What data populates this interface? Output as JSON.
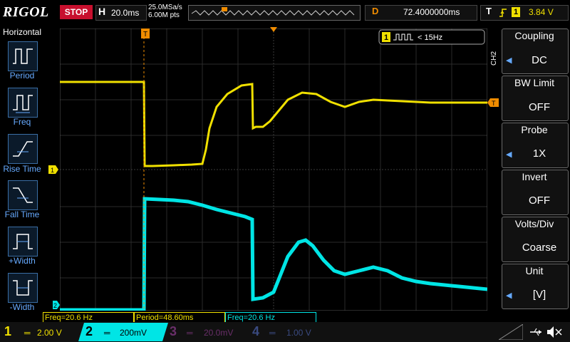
{
  "brand": "RIGOL",
  "run_state": "STOP",
  "horizontal": {
    "label": "H",
    "timebase": "20.0ms",
    "sample_rate": "25.0MSa/s",
    "memory": "6.00M pts"
  },
  "delay": {
    "label": "D",
    "value": "72.4000000ms"
  },
  "trigger": {
    "label": "T",
    "source": "1",
    "level": "3.84 V",
    "marker": "T"
  },
  "left_menu": {
    "title": "Horizontal",
    "items": [
      {
        "label": "Period",
        "icon": "period-icon"
      },
      {
        "label": "Freq",
        "icon": "freq-icon"
      },
      {
        "label": "Rise Time",
        "icon": "rise-time-icon"
      },
      {
        "label": "Fall Time",
        "icon": "fall-time-icon"
      },
      {
        "label": "+Width",
        "icon": "positive-width-icon"
      },
      {
        "label": "-Width",
        "icon": "negative-width-icon"
      }
    ]
  },
  "counter": {
    "channel": "1",
    "text": "< 15Hz"
  },
  "right_menu": {
    "channel_tag": "CH2",
    "items": [
      {
        "header": "Coupling",
        "value": "DC"
      },
      {
        "header": "BW Limit",
        "value": "OFF"
      },
      {
        "header": "Probe",
        "value": "1X"
      },
      {
        "header": "Invert",
        "value": "OFF"
      },
      {
        "header": "Volts/Div",
        "value": "Coarse"
      },
      {
        "header": "Unit",
        "value": "[V]"
      }
    ]
  },
  "measurements": [
    {
      "text": "Freq=20.6 Hz",
      "channel": 1
    },
    {
      "text": "Period=48.60ms",
      "channel": 1
    },
    {
      "text": "Freq=20.6 Hz",
      "channel": 2
    }
  ],
  "channels": [
    {
      "num": "1",
      "scale": "2.00 V",
      "color": "#f0e000",
      "active": true
    },
    {
      "num": "2",
      "scale": "200mV",
      "color": "#00e5e5",
      "active": true
    },
    {
      "num": "3",
      "scale": "20.0mV",
      "color": "#c040c0",
      "active": false
    },
    {
      "num": "4",
      "scale": "1.00 V",
      "color": "#4060c0",
      "active": false
    }
  ],
  "colors": {
    "ch1": "#f0e000",
    "ch2": "#00e5e5",
    "accent": "#f08c00",
    "stop": "#c8102e"
  }
}
